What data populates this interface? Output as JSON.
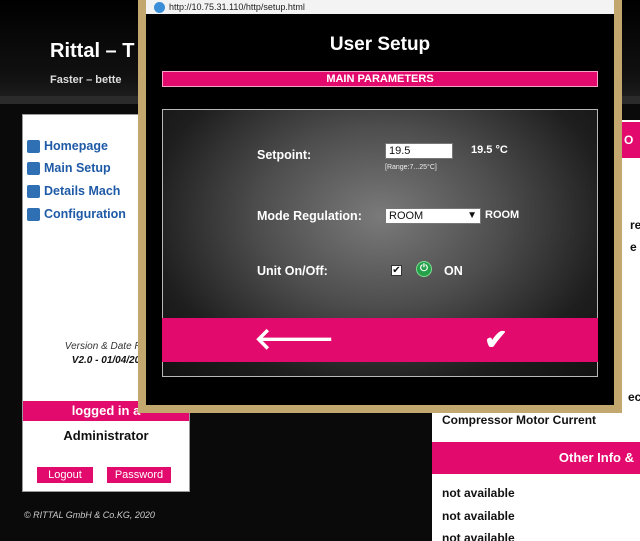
{
  "background": {
    "title": "Rittal – T",
    "tagline": "Faster – bette",
    "copyright": "© RITTAL GmbH & Co.KG, 2020"
  },
  "sidebar": {
    "items": [
      {
        "label": "Homepage",
        "icon": "home-icon"
      },
      {
        "label": "Main Setup",
        "icon": "setup-icon"
      },
      {
        "label": "Details Mach",
        "icon": "details-icon"
      },
      {
        "label": "Configuration",
        "icon": "config-icon"
      }
    ],
    "version_label": "Version & Date Re",
    "version_value": "V2.0 - 01/04/20",
    "logged_in": "logged in a",
    "user": "Administrator",
    "logout": "Logout",
    "password": "Password"
  },
  "right_panel": {
    "corner": "O",
    "frag_re": "re",
    "frag_e": "e",
    "frag_ec": "ec",
    "compressor": "Compressor Motor Current",
    "other_info": "Other Info &",
    "na": [
      "not available",
      "not available",
      "not available"
    ]
  },
  "popup": {
    "url": "http://10.75.31.110/http/setup.html",
    "title": "User Setup",
    "section": "MAIN PARAMETERS",
    "setpoint_label": "Setpoint:",
    "setpoint_value": "19.5",
    "setpoint_display": "19.5 °C",
    "range": "[Range:7...25°C]",
    "mode_label": "Mode Regulation:",
    "mode_selected": "ROOM",
    "mode_current": "ROOM",
    "unit_label": "Unit On/Off:",
    "unit_checked": "✔",
    "power_symbol": "⏻",
    "unit_state": "ON",
    "back_symbol": "🡐",
    "ok_symbol": "✔"
  },
  "colors": {
    "accent": "#e20a6c",
    "frame": "#c2a86f",
    "nav_blue": "#1f5aa6",
    "power_green": "#25a14a"
  }
}
